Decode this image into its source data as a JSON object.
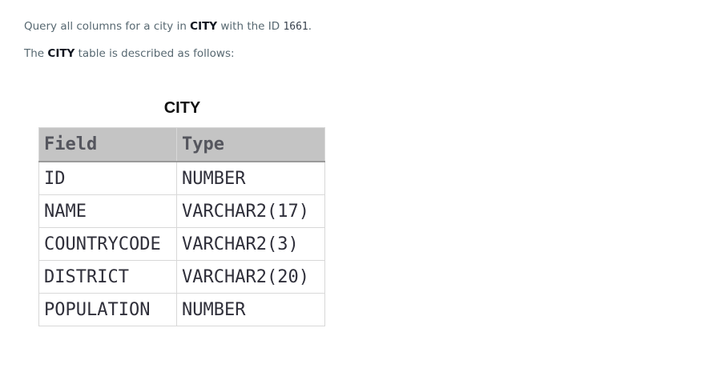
{
  "intro": {
    "text_before": "Query all columns for a city in ",
    "table_name": "CITY",
    "text_middle": " with the ID ",
    "city_id": "1661",
    "text_end": "."
  },
  "description": {
    "text_before": "The ",
    "table_name": "CITY",
    "text_after": " table is described as follows:"
  },
  "schema_table": {
    "title": "CITY",
    "headers": {
      "field": "Field",
      "type": "Type"
    },
    "rows": [
      {
        "field": "ID",
        "type": "NUMBER"
      },
      {
        "field": "NAME",
        "type": "VARCHAR2(17)"
      },
      {
        "field": "COUNTRYCODE",
        "type": "VARCHAR2(3)"
      },
      {
        "field": "DISTRICT",
        "type": "VARCHAR2(20)"
      },
      {
        "field": "POPULATION",
        "type": "NUMBER"
      }
    ]
  }
}
